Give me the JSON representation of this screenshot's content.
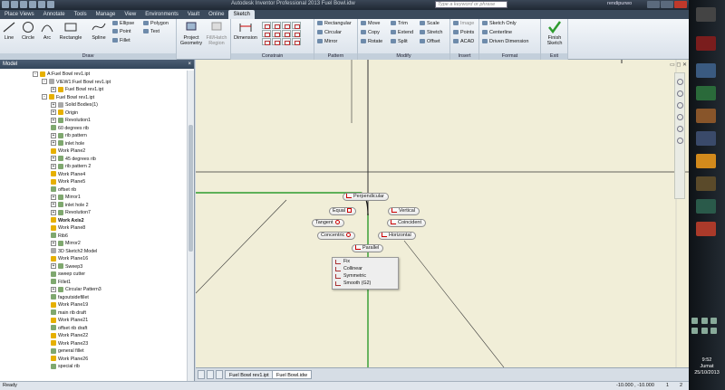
{
  "titlebar": {
    "title": "Autodesk Inventor Professional 2013   Fuel Bowl.idw",
    "search_placeholder": "Type a keyword or phrase",
    "user": "rendipurwo"
  },
  "tabs": [
    "Place Views",
    "Annotate",
    "Tools",
    "Manage",
    "View",
    "Environments",
    "Vault",
    "Online",
    "Sketch"
  ],
  "ribbon": {
    "draw": {
      "label": "Draw",
      "line": "Line",
      "circle": "Circle",
      "arc": "Arc",
      "rectangle": "Rectangle",
      "spline": "Spline",
      "ellipse": "Ellipse",
      "point": "Point",
      "fillet": "Fillet",
      "polygon": "Polygon",
      "text": "Text"
    },
    "project_geometry": "Project Geometry",
    "fill_hatch": "Fill/Hatch Region",
    "constrain": {
      "label": "Constrain",
      "dimension": "Dimension"
    },
    "pattern": {
      "label": "Pattern",
      "rectangular": "Rectangular",
      "circular": "Circular",
      "mirror": "Mirror"
    },
    "modify": {
      "label": "Modify",
      "move": "Move",
      "trim": "Trim",
      "scale": "Scale",
      "copy": "Copy",
      "extend": "Extend",
      "stretch": "Stretch",
      "rotate": "Rotate",
      "split": "Split",
      "offset": "Offset"
    },
    "insert": {
      "label": "Insert",
      "image": "Image",
      "points": "Points",
      "acad": "ACAD"
    },
    "format": {
      "label": "Format",
      "sketch_only": "Sketch Only",
      "centerline": "Centerline",
      "driven_dimension": "Driven Dimension"
    },
    "exit": {
      "label": "Exit",
      "finish_sketch": "Finish Sketch"
    }
  },
  "browser": {
    "title": "Model",
    "tree": [
      {
        "label": "A:Fuel Bowl rev1.ipt",
        "level": 0,
        "icon": "y",
        "exp": "-"
      },
      {
        "label": "VIEW1:Fuel Bowl rev1.ipt",
        "level": 1,
        "icon": "p",
        "exp": "-"
      },
      {
        "label": "Fuel Bowl rev1.ipt",
        "level": 2,
        "icon": "y",
        "exp": "+"
      },
      {
        "label": "Fuel Bowl rev1.ipt",
        "level": 1,
        "icon": "y",
        "exp": "-"
      },
      {
        "label": "Solid Bodies(1)",
        "level": 2,
        "icon": "p",
        "exp": "+"
      },
      {
        "label": "Origin",
        "level": 2,
        "icon": "y",
        "exp": "+"
      },
      {
        "label": "Revolution1",
        "level": 2,
        "icon": "g",
        "exp": "+"
      },
      {
        "label": "60 degrees rib",
        "level": 2,
        "icon": "g",
        "exp": ""
      },
      {
        "label": "rib pattern",
        "level": 2,
        "icon": "g",
        "exp": "+"
      },
      {
        "label": "inlet hole",
        "level": 2,
        "icon": "g",
        "exp": "+"
      },
      {
        "label": "Work Plane2",
        "level": 2,
        "icon": "y",
        "exp": ""
      },
      {
        "label": "45 degrees rib",
        "level": 2,
        "icon": "g",
        "exp": "+"
      },
      {
        "label": "rib pattern 2",
        "level": 2,
        "icon": "g",
        "exp": "+"
      },
      {
        "label": "Work Plane4",
        "level": 2,
        "icon": "y",
        "exp": ""
      },
      {
        "label": "Work Plane5",
        "level": 2,
        "icon": "y",
        "exp": ""
      },
      {
        "label": "offset rib",
        "level": 2,
        "icon": "g",
        "exp": ""
      },
      {
        "label": "Mirror1",
        "level": 2,
        "icon": "g",
        "exp": "+"
      },
      {
        "label": "inlet hole 2",
        "level": 2,
        "icon": "g",
        "exp": "+"
      },
      {
        "label": "Revolution7",
        "level": 2,
        "icon": "g",
        "exp": "+"
      },
      {
        "label": "Work Axis2",
        "level": 2,
        "icon": "y",
        "exp": "",
        "bold": true
      },
      {
        "label": "Work Plane8",
        "level": 2,
        "icon": "y",
        "exp": ""
      },
      {
        "label": "Rib6",
        "level": 2,
        "icon": "g",
        "exp": ""
      },
      {
        "label": "Mirror2",
        "level": 2,
        "icon": "g",
        "exp": "+"
      },
      {
        "label": "3D Sketch2:Model",
        "level": 2,
        "icon": "p",
        "exp": ""
      },
      {
        "label": "Work Plane16",
        "level": 2,
        "icon": "y",
        "exp": ""
      },
      {
        "label": "Sweep3",
        "level": 2,
        "icon": "g",
        "exp": "+"
      },
      {
        "label": "sweep cutter",
        "level": 2,
        "icon": "g",
        "exp": ""
      },
      {
        "label": "Fillet1",
        "level": 2,
        "icon": "g",
        "exp": ""
      },
      {
        "label": "Circular Pattern3",
        "level": 2,
        "icon": "g",
        "exp": "+"
      },
      {
        "label": "fagoutsidefillet",
        "level": 2,
        "icon": "g",
        "exp": ""
      },
      {
        "label": "Work Plane19",
        "level": 2,
        "icon": "y",
        "exp": ""
      },
      {
        "label": "main rib draft",
        "level": 2,
        "icon": "g",
        "exp": ""
      },
      {
        "label": "Work Plane21",
        "level": 2,
        "icon": "y",
        "exp": ""
      },
      {
        "label": "offset rib draft",
        "level": 2,
        "icon": "g",
        "exp": ""
      },
      {
        "label": "Work Plane22",
        "level": 2,
        "icon": "y",
        "exp": ""
      },
      {
        "label": "Work Plane23",
        "level": 2,
        "icon": "y",
        "exp": ""
      },
      {
        "label": "general fillet",
        "level": 2,
        "icon": "g",
        "exp": ""
      },
      {
        "label": "Work Plane26",
        "level": 2,
        "icon": "y",
        "exp": ""
      },
      {
        "label": "special rib",
        "level": 2,
        "icon": "g",
        "exp": ""
      }
    ]
  },
  "constraints": {
    "perpendicular": "Perpendicular",
    "equal": "Equal",
    "vertical": "Vertical",
    "tangent": "Tangent",
    "coincident": "Coincident",
    "concentric": "Concentric",
    "horizontal": "Horizontal",
    "parallel": "Parallel"
  },
  "context_menu": [
    "Fix",
    "Collinear",
    "Symmetric",
    "Smooth (G2)"
  ],
  "doc_tabs": [
    "Fuel Bowl rev1.ipt",
    "Fuel Bowl.idw"
  ],
  "status": {
    "left": "Ready",
    "coords": "-10.000 , -10.000",
    "a": "1",
    "b": "2"
  },
  "clock": {
    "time": "9:52",
    "day": "Jumat",
    "date": "25/10/2013"
  },
  "colors": {
    "accent_green": "#2e9b2e",
    "canvas": "#f1eed8"
  }
}
